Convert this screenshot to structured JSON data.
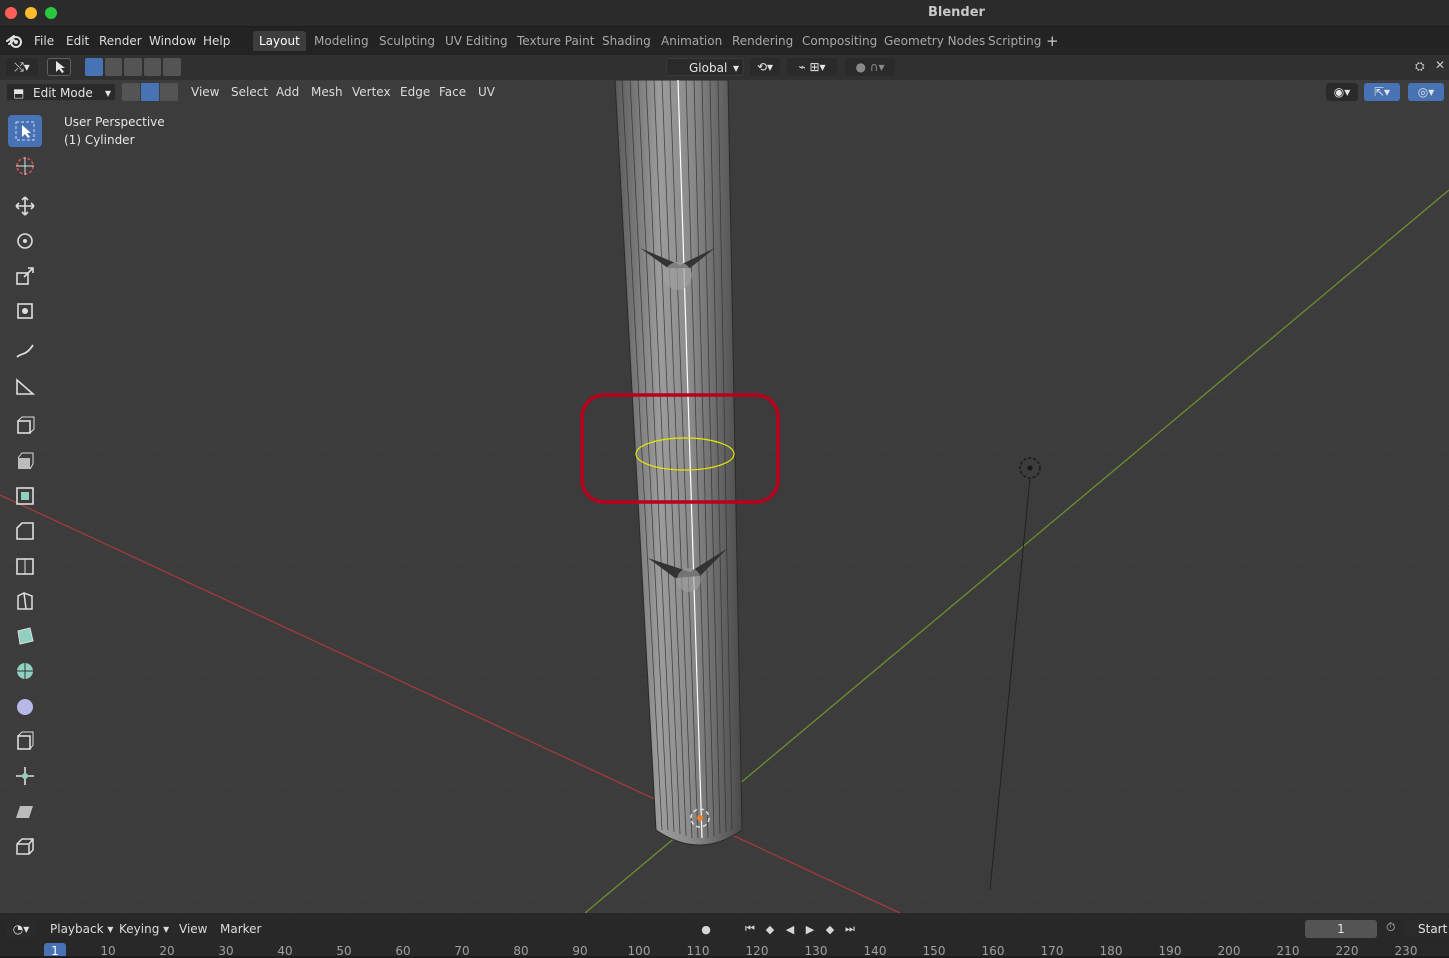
{
  "window": {
    "title": "Blender",
    "colors": {
      "close": "#ff5f57",
      "minimize": "#febc2e",
      "maximize": "#28c840"
    }
  },
  "menubar": {
    "items": [
      "File",
      "Edit",
      "Render",
      "Window",
      "Help"
    ],
    "workspace_tabs": [
      "Layout",
      "Modeling",
      "Sculpting",
      "UV Editing",
      "Texture Paint",
      "Shading",
      "Animation",
      "Rendering",
      "Compositing",
      "Geometry Nodes",
      "Scripting"
    ],
    "active_tab": "Layout",
    "add_tab_icon": "plus-icon"
  },
  "header": {
    "transform_orientation": "Global",
    "mode": "Edit Mode",
    "menus": [
      "View",
      "Select",
      "Add",
      "Mesh",
      "Vertex",
      "Edge",
      "Face",
      "UV"
    ]
  },
  "viewport": {
    "perspective_label": "User Perspective",
    "object_label": "(1) Cylinder",
    "highlight_color": "#b8001c",
    "selection_color": "#e6e600"
  },
  "toolbar": {
    "tools": [
      "select-box-icon",
      "cursor-icon",
      "move-icon",
      "rotate-icon",
      "scale-icon",
      "transform-icon",
      "annotate-icon",
      "measure-icon",
      "add-cube-icon",
      "extrude-icon",
      "inset-icon",
      "bevel-icon",
      "loop-cut-icon",
      "knife-icon",
      "poly-build-icon",
      "spin-icon",
      "smooth-icon",
      "edge-slide-icon",
      "shrink-fatten-icon",
      "shear-icon",
      "rip-region-icon"
    ],
    "active_index": 0
  },
  "timeline": {
    "menus": [
      "Playback",
      "Keying",
      "View",
      "Marker"
    ],
    "current_frame": "1",
    "start_label": "Start",
    "ticks": [
      "1",
      "10",
      "20",
      "30",
      "40",
      "50",
      "60",
      "70",
      "80",
      "90",
      "100",
      "110",
      "120",
      "130",
      "140",
      "150",
      "160",
      "170",
      "180",
      "190",
      "200",
      "210",
      "220",
      "230"
    ]
  }
}
